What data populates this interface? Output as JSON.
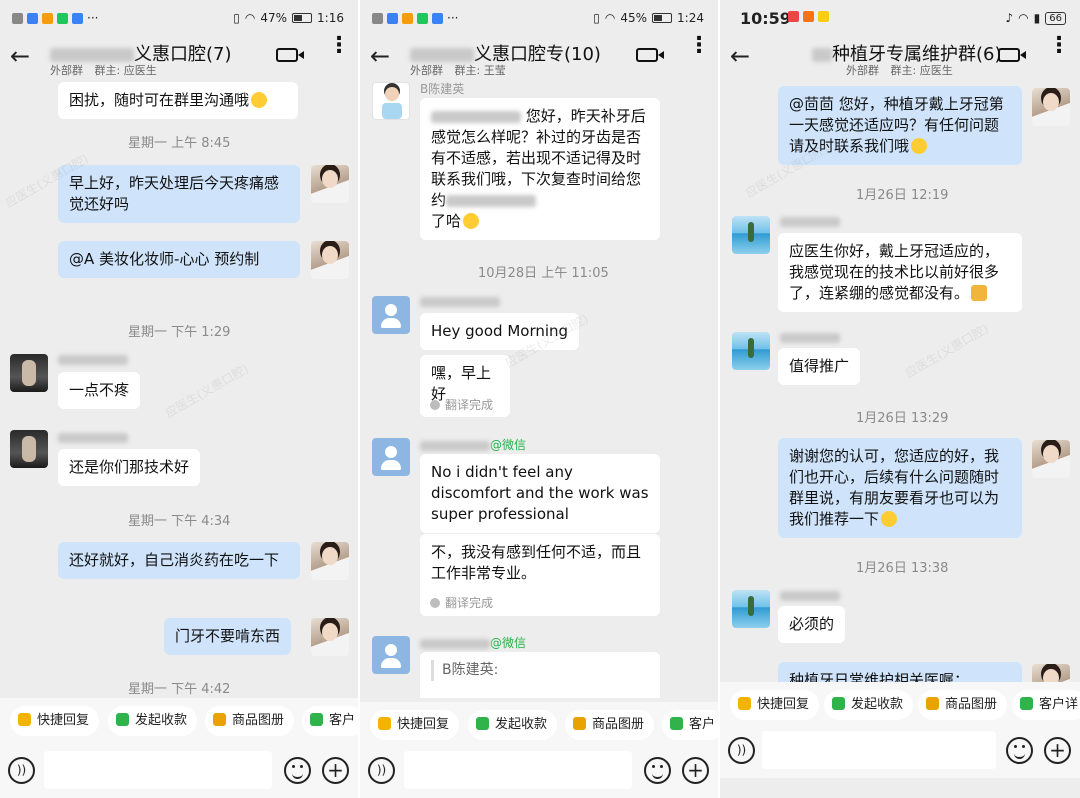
{
  "panels": [
    {
      "status": {
        "battery": "47%",
        "time": "1:16"
      },
      "header": {
        "title_suffix": "义惠口腔(7)",
        "external": "外部群",
        "owner": "群主: 应医生"
      },
      "timestamps": [
        "星期一 上午 8:45",
        "星期一 下午 1:29",
        "星期一 下午 4:34",
        "星期一 下午 4:42"
      ],
      "messages": [
        "困扰，随时可在群里沟通哦",
        "早上好，昨天处理后今天疼痛感觉还好吗",
        "@A   美妆化妆师-心心  预约制",
        "一点不疼",
        "还是你们那技术好",
        "还好就好，自己消炎药在吃一下",
        "门牙不要啃东西"
      ]
    },
    {
      "status": {
        "battery": "45%",
        "time": "1:24"
      },
      "header": {
        "title_suffix": "义惠口腔专(10)",
        "external": "外部群",
        "owner": "群主: 王莹"
      },
      "sender_top": "B陈建英",
      "timestamps": [
        "10月28日 上午 11:05"
      ],
      "messages": [
        "您好，昨天补牙后感觉怎么样呢？补过的牙齿是否有不适感，若出现不适记得及时联系我们哦，下次复查时间给您约",
        "了哈",
        "Hey good Morning",
        "嘿，早上好",
        "No i didn't feel any discomfort and the work was super professional",
        "不，我没有感到任何不适，而且工作非常专业。",
        "B陈建英:"
      ],
      "wechat": "@微信",
      "translate_done": "翻译完成"
    },
    {
      "status": {
        "time": "10:59",
        "battery": "66"
      },
      "header": {
        "title_suffix": "种植牙专属维护群(6)",
        "external": "外部群",
        "owner": "群主: 应医生"
      },
      "timestamps": [
        "1月26日 12:19",
        "1月26日 13:29",
        "1月26日 13:38"
      ],
      "messages": [
        "@茴茴  您好，种植牙戴上牙冠第一天感觉还适应吗？有任何问题请及时联系我们哦",
        "应医生你好，戴上牙冠适应的，我感觉现在的技术比以前好很多了，连紧绷的感觉都没有。",
        "值得推广",
        "谢谢您的认可，您适应的好，我们也开心，后续有什么问题随时群里说，有朋友要看牙也可以为我们推荐一下",
        "必须的",
        "种植牙日常维护相关医嘱："
      ]
    }
  ],
  "quick": {
    "reply": "快捷回复",
    "payment": "发起收款",
    "catalog": "商品图册",
    "customer": "客户",
    "customer_detail": "客户详"
  },
  "colors": {
    "bubble_blue": "#cfe4fb",
    "bubble_white": "#ffffff",
    "background": "#ededed",
    "wechat_green": "#27b24a"
  }
}
